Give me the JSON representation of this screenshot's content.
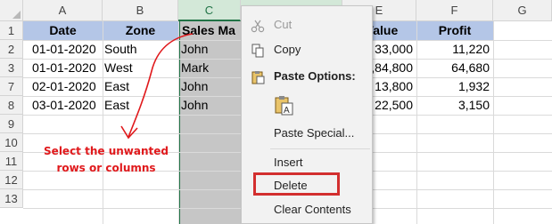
{
  "columns": [
    "A",
    "B",
    "C",
    "D",
    "E",
    "F",
    "G"
  ],
  "rows": [
    "1",
    "2",
    "3",
    "7",
    "8",
    "9",
    "10",
    "11",
    "12",
    "13"
  ],
  "table": {
    "headers": [
      "Date",
      "Zone",
      "Sales Ma",
      "s Value",
      "Profit"
    ],
    "data": [
      [
        "01-01-2020",
        "South",
        "John",
        "33,000",
        "11,220"
      ],
      [
        "01-01-2020",
        "West",
        "Mark",
        ",84,800",
        "64,680"
      ],
      [
        "02-01-2020",
        "East",
        "John",
        "13,800",
        "1,932"
      ],
      [
        "03-01-2020",
        "East",
        "John",
        "22,500",
        "3,150"
      ]
    ]
  },
  "annotation": {
    "line1": "Select the unwanted",
    "line2": "rows or columns",
    "color": "#e0191c"
  },
  "context_menu": {
    "cut": "Cut",
    "copy": "Copy",
    "paste_options": "Paste Options:",
    "paste_special": "Paste Special...",
    "insert": "Insert",
    "delete": "Delete",
    "clear_contents": "Clear Contents"
  },
  "colors": {
    "header_fill": "#b4c6e7",
    "selection_fill": "#c6c6c6",
    "selection_accent": "#217346",
    "highlight_box": "#d32f2f"
  }
}
